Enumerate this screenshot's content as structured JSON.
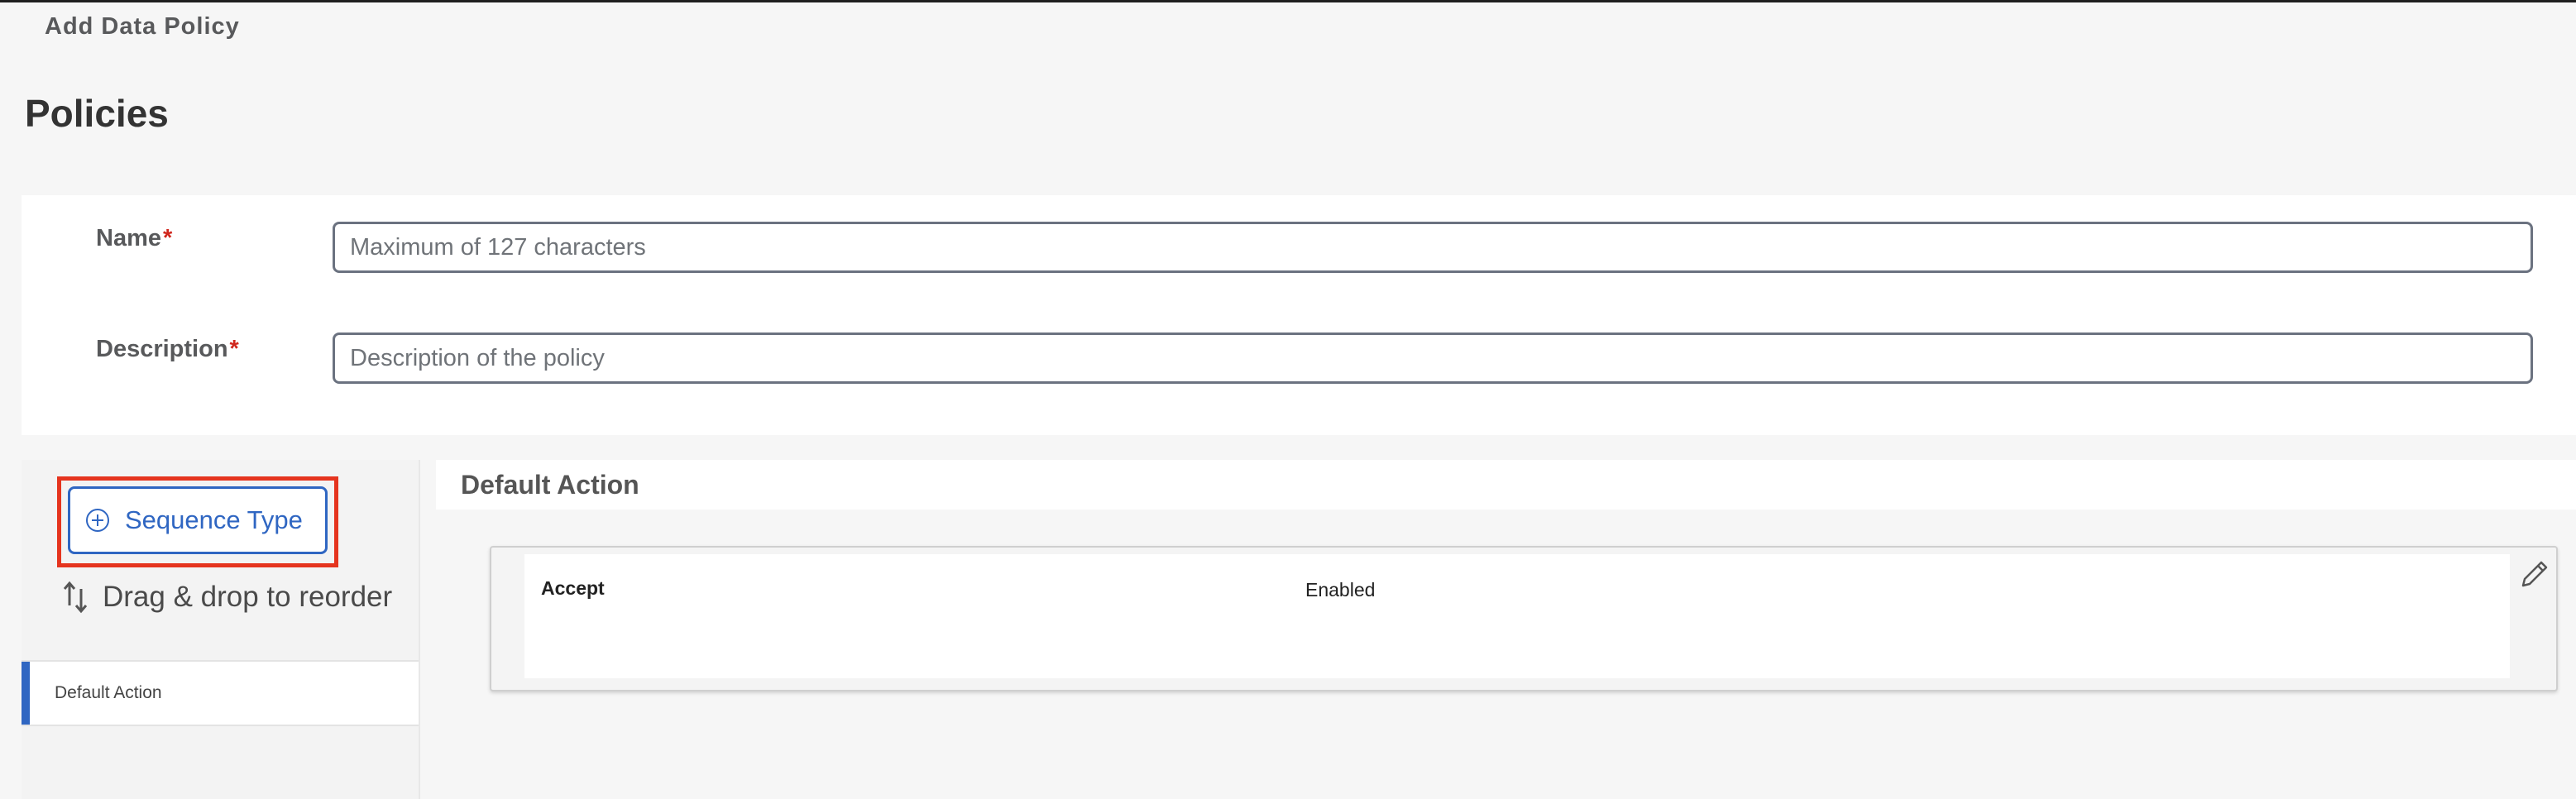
{
  "header": {
    "breadcrumb": "Add Data Policy",
    "page_title": "Policies"
  },
  "form": {
    "name_label": "Name",
    "name_placeholder": "Maximum of 127 characters",
    "name_value": "",
    "description_label": "Description",
    "description_placeholder": "Description of the policy",
    "description_value": "",
    "required_marker": "*"
  },
  "sidebar": {
    "sequence_type_button": "Sequence Type",
    "plus_icon": "plus-circle-icon",
    "reorder_hint": "Drag & drop to reorder",
    "reorder_icon": "reorder-arrows-icon",
    "items": [
      {
        "label": "Default Action"
      }
    ]
  },
  "default_action": {
    "title": "Default Action",
    "action": "Accept",
    "status": "Enabled",
    "edit_icon": "pencil-edit-icon"
  },
  "colors": {
    "accent": "#2f66c2",
    "required": "#d0271d",
    "highlight": "#e5341e"
  }
}
